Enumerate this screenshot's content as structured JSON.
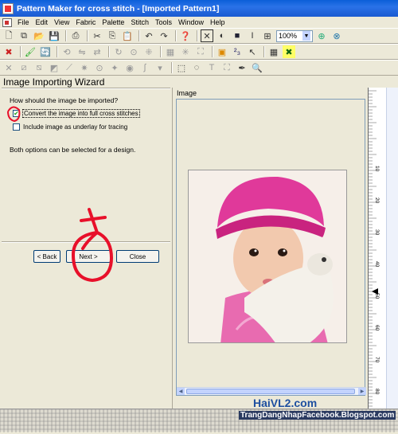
{
  "window": {
    "title": "Pattern Maker for cross stitch - [Imported Pattern1]"
  },
  "menu": [
    "File",
    "Edit",
    "View",
    "Fabric",
    "Palette",
    "Stitch",
    "Tools",
    "Window",
    "Help"
  ],
  "toolbar": {
    "zoom_value": "100%"
  },
  "wizard": {
    "title": "Image Importing Wizard",
    "question": "How should the image be imported?",
    "options": [
      {
        "label": "Convert the image into full cross stitches",
        "checked": true
      },
      {
        "label": "Include image as underlay for tracing",
        "checked": false
      }
    ],
    "note": "Both options can be selected for a design.",
    "buttons": {
      "back": "< Back",
      "next": "Next >",
      "close": "Close"
    }
  },
  "image_panel": {
    "title": "Image"
  },
  "ruler_labels": [
    "10",
    "20",
    "30",
    "40",
    "50",
    "60",
    "70",
    "80",
    "90"
  ],
  "watermark": {
    "line1": "HaiVL2.com",
    "line2": "TrangDangNhapFacebook.Blogspot.com"
  },
  "colors": {
    "title_bar": "#0a5fd8",
    "annotation": "#e8102a"
  }
}
